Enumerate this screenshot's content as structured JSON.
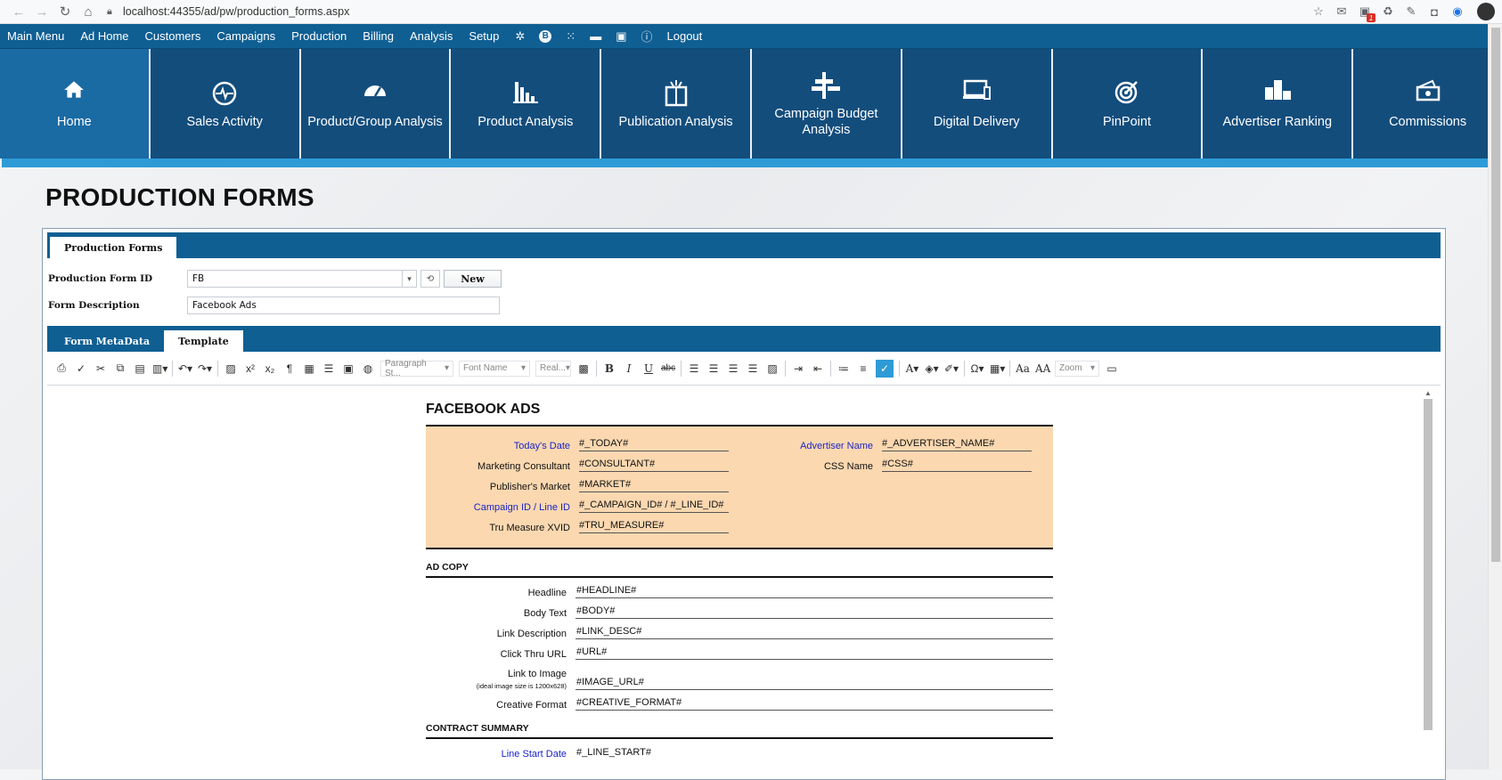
{
  "browser": {
    "url": "localhost:44355/ad/pw/production_forms.aspx",
    "ext_badge": "1"
  },
  "menu": {
    "items": [
      "Main Menu",
      "Ad Home",
      "Customers",
      "Campaigns",
      "Production",
      "Billing",
      "Analysis",
      "Setup"
    ],
    "logout": "Logout"
  },
  "tiles": [
    {
      "label": "Home",
      "icon": "home-icon"
    },
    {
      "label": "Sales Activity",
      "icon": "activity-icon"
    },
    {
      "label": "Product/Group Analysis",
      "icon": "gauge-icon"
    },
    {
      "label": "Product Analysis",
      "icon": "bar-chart-icon"
    },
    {
      "label": "Publication Analysis",
      "icon": "book-icon"
    },
    {
      "label": "Campaign Budget Analysis",
      "icon": "budget-icon"
    },
    {
      "label": "Digital Delivery",
      "icon": "devices-icon"
    },
    {
      "label": "PinPoint",
      "icon": "target-icon"
    },
    {
      "label": "Advertiser Ranking",
      "icon": "podium-icon"
    },
    {
      "label": "Commissions",
      "icon": "money-icon"
    }
  ],
  "page": {
    "title": "PRODUCTION FORMS"
  },
  "panel": {
    "tab": "Production Forms",
    "form_id_label": "Production Form ID",
    "form_id_value": "FB",
    "new_button": "New",
    "desc_label": "Form Description",
    "desc_value": "Facebook Ads",
    "subtabs": [
      "Form MetaData",
      "Template"
    ]
  },
  "toolbar": {
    "paragraph_style": "Paragraph St...",
    "font_name": "Font Name",
    "font_size": "Real...",
    "zoom": "Zoom"
  },
  "doc": {
    "title": "FACEBOOK ADS",
    "header_left": [
      {
        "label": "Today's Date",
        "value": "#_TODAY#",
        "blue": true
      },
      {
        "label": "Marketing Consultant",
        "value": "#CONSULTANT#",
        "blue": false
      },
      {
        "label": "Publisher's Market",
        "value": "#MARKET#",
        "blue": false
      },
      {
        "label": "Campaign ID / Line ID",
        "value": "#_CAMPAIGN_ID# / #_LINE_ID#",
        "blue": true
      },
      {
        "label": "Tru Measure XVID",
        "value": "#TRU_MEASURE#",
        "blue": false
      }
    ],
    "header_right": [
      {
        "label": "Advertiser Name",
        "value": "#_ADVERTISER_NAME#",
        "blue": true
      },
      {
        "label": "CSS Name",
        "value": "#CSS#",
        "blue": false
      }
    ],
    "ad_copy_title": "AD COPY",
    "ad_copy": [
      {
        "label": "Headline",
        "value": "#HEADLINE#"
      },
      {
        "label": "Body Text",
        "value": "#BODY#"
      },
      {
        "label": "Link Description",
        "value": "#LINK_DESC#"
      },
      {
        "label": "Click Thru URL",
        "value": "#URL#"
      },
      {
        "label": "Link to Image",
        "note": "(ideal image size is 1200x628)",
        "value": "#IMAGE_URL#"
      },
      {
        "label": "Creative Format",
        "value": "#CREATIVE_FORMAT#"
      }
    ],
    "contract_title": "CONTRACT SUMMARY",
    "contract": [
      {
        "label": "Line Start Date",
        "value": "#_LINE_START#",
        "blue": true
      }
    ]
  }
}
